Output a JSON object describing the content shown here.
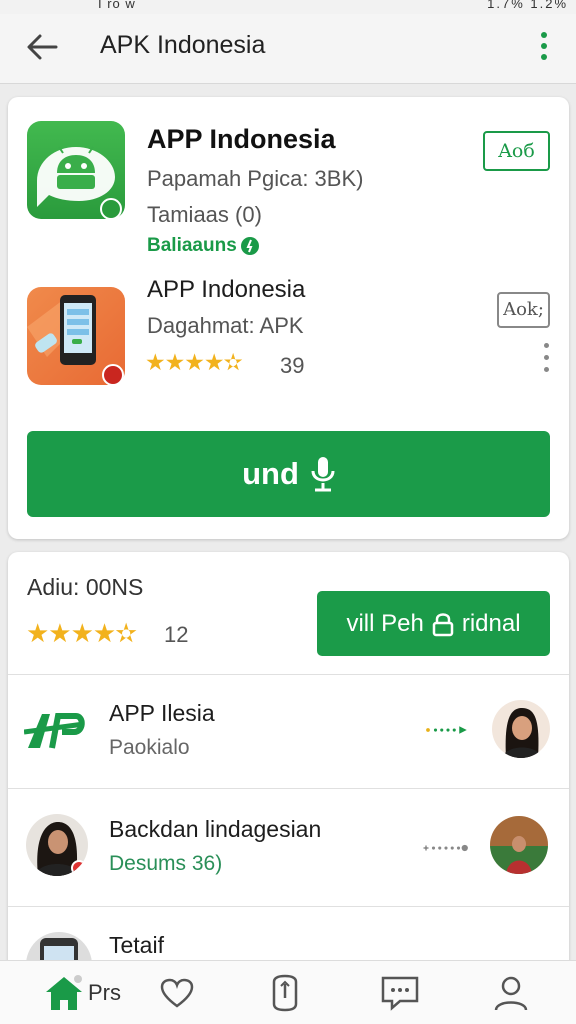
{
  "status_bar": {
    "left_text": "I ro w",
    "right_text": "1.7% 1.2%"
  },
  "app_bar": {
    "title": "APK Indonesia",
    "back_icon": "arrow-left-icon",
    "more_icon": "more-vertical-icon"
  },
  "featured": {
    "app1": {
      "name": "APP Indonesia",
      "meta": "Papamah Pgica: 3BK)",
      "status": "Tamiaas (0)",
      "badge": "Baliaauns",
      "button_label": "Aoб"
    },
    "app2": {
      "name": "APP Indonesia",
      "meta": "Dagahmat: APK",
      "rating": "★★★★✫",
      "rating_count": "39",
      "button_label": "Aok;"
    },
    "primary_button": {
      "label": "und",
      "icon": "download-icon"
    }
  },
  "ratings_section": {
    "label": "Adiu: 00NS",
    "stars": "★★★★✫",
    "count": "12",
    "button_label": "vill Peh",
    "button_label_2": "ridnal",
    "button_icon": "lock-icon"
  },
  "list": [
    {
      "title": "APP Ilesia",
      "subtitle": "Paokialo"
    },
    {
      "title": "Backdan lindagesian",
      "subtitle": "Desums 36)"
    },
    {
      "title": "Tetaif",
      "subtitle": ""
    }
  ],
  "bottom_nav": {
    "items": [
      {
        "label": "Prs",
        "icon": "home-icon"
      },
      {
        "label": "",
        "icon": "heart-icon"
      },
      {
        "label": "",
        "icon": "compass-icon"
      },
      {
        "label": "",
        "icon": "chat-icon"
      },
      {
        "label": "",
        "icon": "profile-icon"
      }
    ]
  },
  "colors": {
    "accent": "#1b9b49",
    "star": "#f2b21d"
  }
}
